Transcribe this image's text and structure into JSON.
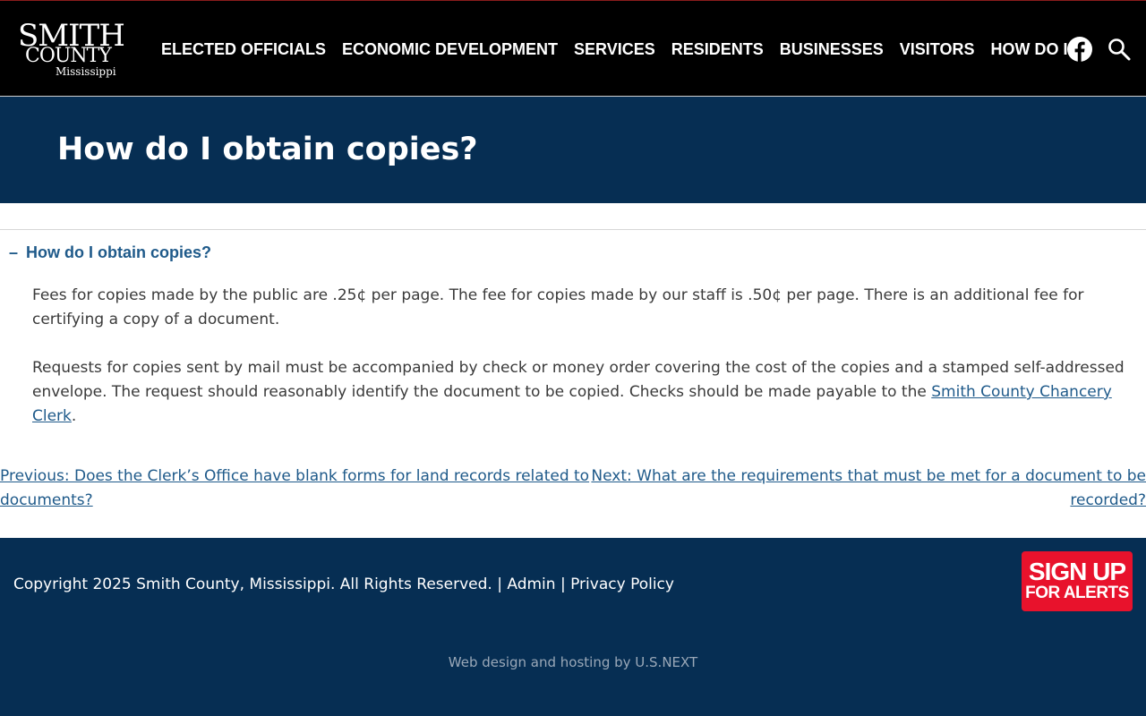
{
  "header": {
    "logo": {
      "line1": "SMITH",
      "line2": "COUNTY",
      "line3": "Mississippi"
    },
    "nav": [
      "ELECTED OFFICIALS",
      "ECONOMIC DEVELOPMENT",
      "SERVICES",
      "RESIDENTS",
      "BUSINESSES",
      "VISITORS",
      "HOW DO I?"
    ],
    "icons": {
      "social": "facebook-icon",
      "search": "search-icon"
    }
  },
  "page": {
    "title": "How do I obtain copies?"
  },
  "accordion": {
    "toggle_symbol": "–",
    "title": "How do I obtain copies?",
    "paragraph1": "Fees for copies made by the public are .25¢ per page. The fee for copies made by our staff is .50¢ per page. There is an additional fee for certifying a copy of a document.",
    "paragraph2_text": "Requests for copies sent by mail must be accompanied by check or money order covering the cost of the copies and a stamped self-addressed envelope. The request should reasonably identify the document to be copied. Checks should be made payable to the ",
    "paragraph2_link": "Smith County Chancery Clerk",
    "paragraph2_end": "."
  },
  "post_nav": {
    "previous": "Previous: Does the Clerk’s Office have blank forms for land records related to documents?",
    "next": "Next: What are the requirements that must be met for a document to be recorded?"
  },
  "footer": {
    "copyright": "Copyright 2025 Smith County, Mississippi. All Rights Reserved.",
    "sep1": " | ",
    "admin": "Admin",
    "sep2": " | ",
    "privacy": "Privacy Policy",
    "signup_line1": "SIGN UP",
    "signup_line2": "FOR ALERTS",
    "credit": "Web design and hosting by U.S.NEXT"
  },
  "colors": {
    "header_bg": "#000000",
    "title_band": "#062e53",
    "footer_bg": "#062e53",
    "link": "#1f5a8a",
    "signup": "#e8122c"
  }
}
